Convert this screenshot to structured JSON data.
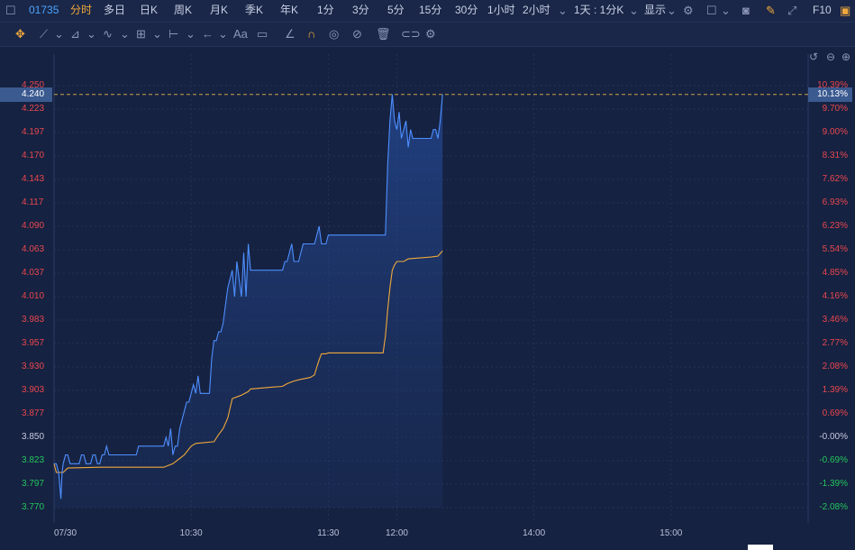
{
  "toolbar": {
    "code": "01735",
    "periods": [
      "分时",
      "多日",
      "日K",
      "周K",
      "月K",
      "季K",
      "年K",
      "1分",
      "3分",
      "5分",
      "15分",
      "30分",
      "1小时",
      "2小时"
    ],
    "active_period": "分时",
    "kline_setting": "1天 : 1分K",
    "display_label": "显示",
    "f10_label": "F10"
  },
  "drawing_tools": {
    "move_icon": "move-icon",
    "text_tool": "Aa"
  },
  "colors": {
    "background": "#162241",
    "price_line": "#4e8fff",
    "avg_line": "#f0a83c",
    "up": "#e8474f",
    "down": "#22c55e",
    "flat": "#c6cbe0",
    "reference_line": "#c9a24a"
  },
  "current_price": "4.240",
  "current_pct": "10.13%",
  "chart_data": {
    "type": "line",
    "prev_close": 3.85,
    "ylim": [
      3.77,
      4.25
    ],
    "y_ticks_left": [
      "4.250",
      "4.223",
      "4.197",
      "4.170",
      "4.143",
      "4.117",
      "4.090",
      "4.063",
      "4.037",
      "4.010",
      "3.983",
      "3.957",
      "3.930",
      "3.903",
      "3.877",
      "3.850",
      "3.823",
      "3.797",
      "3.770"
    ],
    "y_ticks_right": [
      "10.39%",
      "9.70%",
      "9.00%",
      "8.31%",
      "7.62%",
      "6.93%",
      "6.23%",
      "5.54%",
      "4.85%",
      "4.16%",
      "3.46%",
      "2.77%",
      "2.08%",
      "1.39%",
      "0.69%",
      "-0.00%",
      "-0.69%",
      "-1.39%",
      "-2.08%"
    ],
    "x_ticks": [
      {
        "label": "07/30",
        "t": 0
      },
      {
        "label": "10:30",
        "t": 60
      },
      {
        "label": "11:30",
        "t": 120
      },
      {
        "label": "12:00",
        "t": 150
      },
      {
        "label": "14:00",
        "t": 210
      },
      {
        "label": "15:00",
        "t": 270
      }
    ],
    "t_range": [
      0,
      330
    ],
    "grid": true,
    "series": [
      {
        "key": "price",
        "points": [
          [
            0,
            3.82
          ],
          [
            1,
            3.82
          ],
          [
            2,
            3.81
          ],
          [
            3,
            3.78
          ],
          [
            3.5,
            3.81
          ],
          [
            4,
            3.82
          ],
          [
            5,
            3.83
          ],
          [
            6,
            3.83
          ],
          [
            7,
            3.82
          ],
          [
            8,
            3.82
          ],
          [
            10,
            3.82
          ],
          [
            11,
            3.82
          ],
          [
            12,
            3.83
          ],
          [
            13,
            3.83
          ],
          [
            14,
            3.82
          ],
          [
            16,
            3.82
          ],
          [
            17,
            3.83
          ],
          [
            18,
            3.83
          ],
          [
            19,
            3.82
          ],
          [
            20,
            3.82
          ],
          [
            21,
            3.83
          ],
          [
            22,
            3.83
          ],
          [
            23,
            3.84
          ],
          [
            24,
            3.83
          ],
          [
            36,
            3.83
          ],
          [
            37,
            3.84
          ],
          [
            48,
            3.84
          ],
          [
            49,
            3.85
          ],
          [
            50,
            3.84
          ],
          [
            51,
            3.86
          ],
          [
            52,
            3.83
          ],
          [
            53,
            3.84
          ],
          [
            54,
            3.84
          ],
          [
            55,
            3.86
          ],
          [
            56,
            3.87
          ],
          [
            57,
            3.88
          ],
          [
            58,
            3.89
          ],
          [
            59,
            3.89
          ],
          [
            60,
            3.9
          ],
          [
            61,
            3.91
          ],
          [
            62,
            3.9
          ],
          [
            63,
            3.92
          ],
          [
            64,
            3.9
          ],
          [
            68,
            3.9
          ],
          [
            69,
            3.94
          ],
          [
            70,
            3.96
          ],
          [
            71,
            3.96
          ],
          [
            72,
            3.97
          ],
          [
            73,
            3.97
          ],
          [
            74,
            3.98
          ],
          [
            75,
            4.0
          ],
          [
            76,
            4.02
          ],
          [
            77,
            4.03
          ],
          [
            78,
            4.04
          ],
          [
            79,
            4.01
          ],
          [
            80,
            4.05
          ],
          [
            81,
            4.03
          ],
          [
            82,
            4.01
          ],
          [
            83,
            4.06
          ],
          [
            84,
            4.01
          ],
          [
            85,
            4.07
          ],
          [
            86,
            4.04
          ],
          [
            100,
            4.04
          ],
          [
            101,
            4.05
          ],
          [
            102,
            4.05
          ],
          [
            103,
            4.06
          ],
          [
            104,
            4.07
          ],
          [
            105,
            4.05
          ],
          [
            106,
            4.05
          ],
          [
            107,
            4.05
          ],
          [
            108,
            4.06
          ],
          [
            109,
            4.07
          ],
          [
            110,
            4.07
          ],
          [
            114,
            4.07
          ],
          [
            115,
            4.08
          ],
          [
            116,
            4.09
          ],
          [
            117,
            4.07
          ],
          [
            118,
            4.07
          ],
          [
            119,
            4.07
          ],
          [
            120,
            4.08
          ],
          [
            145,
            4.08
          ],
          [
            146,
            4.16
          ],
          [
            147,
            4.21
          ],
          [
            148,
            4.24
          ],
          [
            149,
            4.21
          ],
          [
            150,
            4.2
          ],
          [
            151,
            4.22
          ],
          [
            152,
            4.19
          ],
          [
            153,
            4.2
          ],
          [
            154,
            4.21
          ],
          [
            155,
            4.18
          ],
          [
            156,
            4.2
          ],
          [
            157,
            4.19
          ],
          [
            165,
            4.19
          ],
          [
            166,
            4.2
          ],
          [
            167,
            4.2
          ],
          [
            168,
            4.19
          ],
          [
            169,
            4.21
          ],
          [
            170,
            4.24
          ]
        ]
      },
      {
        "key": "avg",
        "points": [
          [
            0,
            3.82
          ],
          [
            1,
            3.81
          ],
          [
            3,
            3.81
          ],
          [
            4,
            3.81
          ],
          [
            6,
            3.815
          ],
          [
            20,
            3.816
          ],
          [
            30,
            3.816
          ],
          [
            36,
            3.816
          ],
          [
            48,
            3.816
          ],
          [
            50,
            3.818
          ],
          [
            52,
            3.82
          ],
          [
            55,
            3.826
          ],
          [
            57,
            3.83
          ],
          [
            60,
            3.84
          ],
          [
            62,
            3.843
          ],
          [
            70,
            3.845
          ],
          [
            72,
            3.853
          ],
          [
            74,
            3.86
          ],
          [
            76,
            3.872
          ],
          [
            78,
            3.894
          ],
          [
            80,
            3.896
          ],
          [
            82,
            3.898
          ],
          [
            85,
            3.902
          ],
          [
            86,
            3.905
          ],
          [
            95,
            3.907
          ],
          [
            100,
            3.908
          ],
          [
            102,
            3.911
          ],
          [
            105,
            3.914
          ],
          [
            108,
            3.916
          ],
          [
            112,
            3.918
          ],
          [
            114,
            3.921
          ],
          [
            115,
            3.93
          ],
          [
            116,
            3.938
          ],
          [
            117,
            3.945
          ],
          [
            119,
            3.945
          ],
          [
            120,
            3.946
          ],
          [
            140,
            3.946
          ],
          [
            144,
            3.946
          ],
          [
            145,
            3.965
          ],
          [
            146,
            3.995
          ],
          [
            147,
            4.02
          ],
          [
            148,
            4.04
          ],
          [
            149,
            4.046
          ],
          [
            150,
            4.05
          ],
          [
            153,
            4.05
          ],
          [
            155,
            4.053
          ],
          [
            160,
            4.054
          ],
          [
            165,
            4.055
          ],
          [
            168,
            4.056
          ],
          [
            170,
            4.062
          ]
        ]
      }
    ]
  }
}
